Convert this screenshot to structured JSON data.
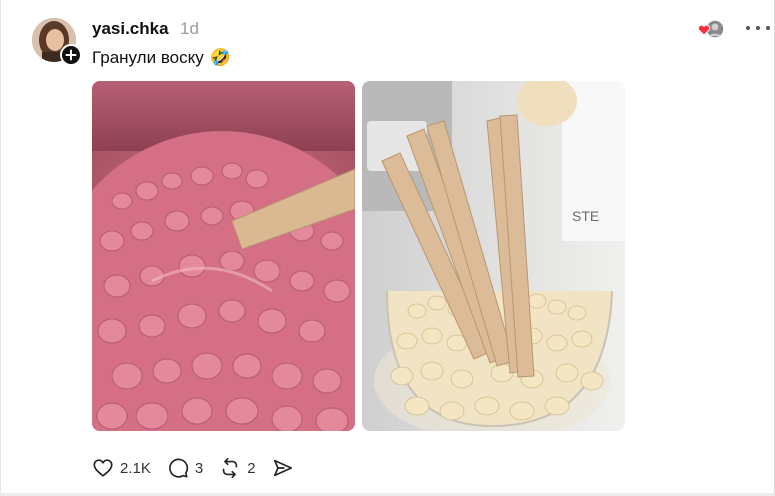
{
  "post": {
    "username": "yasi.chka",
    "timestamp": "1d",
    "caption": "Гранули воску",
    "caption_emoji": "🤣"
  },
  "actions": {
    "likes": "2.1K",
    "comments": "3",
    "reposts": "2"
  },
  "icons": [
    "plus-icon",
    "heart-icon",
    "comment-icon",
    "repost-icon",
    "share-icon",
    "more-icon"
  ],
  "colors": {
    "text": "#101010",
    "muted": "#9a9a9a",
    "pink_wax": "#cf6a80",
    "white_wax": "#f2e2bf",
    "stick": "#d9b892",
    "like_red": "#ff3040"
  }
}
